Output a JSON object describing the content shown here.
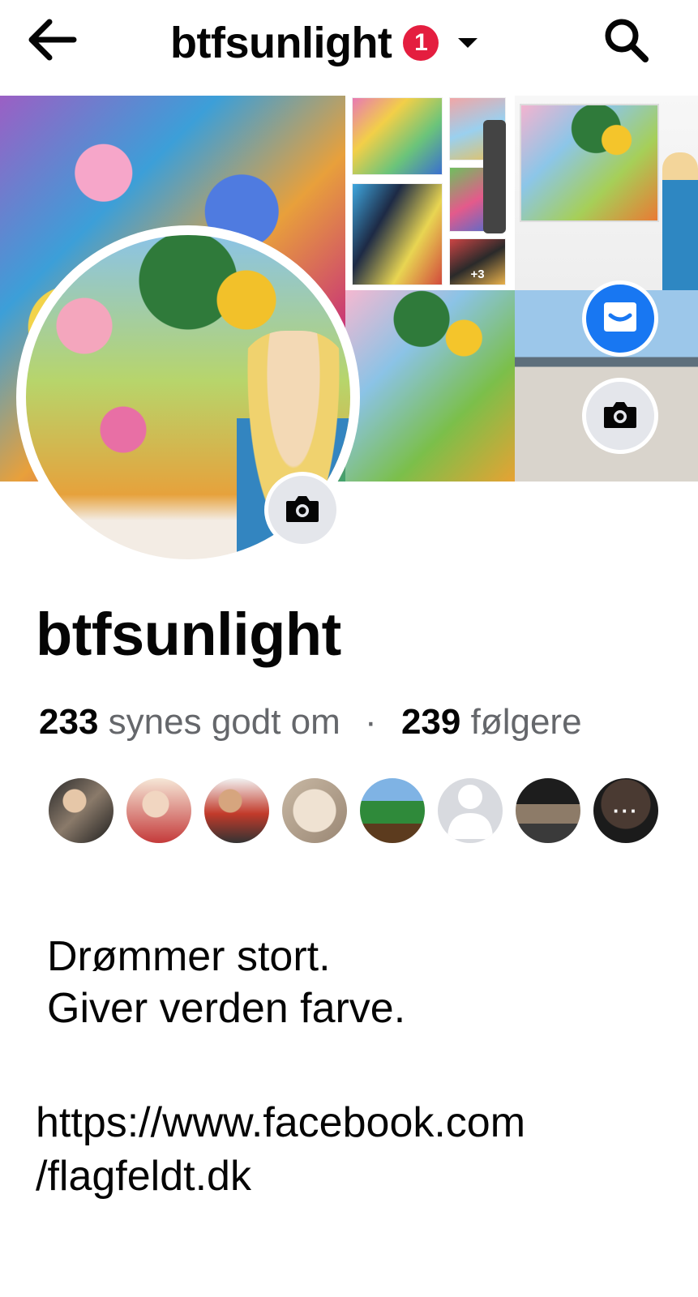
{
  "header": {
    "title": "btfsunlight",
    "notification_count": "1",
    "back_icon": "arrow-left-icon",
    "search_icon": "search-icon"
  },
  "cover": {
    "more_label": "+3",
    "accent_color": "#1877f2"
  },
  "profile": {
    "name": "btfsunlight",
    "likes_count": "233",
    "likes_label": "synes godt om",
    "separator": "·",
    "followers_count": "239",
    "followers_label": "følgere",
    "more_friends_label": "···"
  },
  "bio": {
    "line1": "Drømmer stort.",
    "line2": "Giver verden farve."
  },
  "links": {
    "line1": "https://www.facebook.com",
    "line2": "/flagfeldt.dk"
  }
}
